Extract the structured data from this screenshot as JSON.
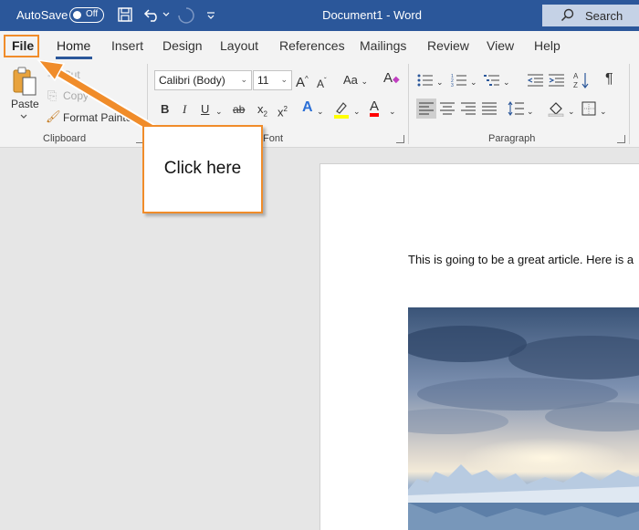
{
  "titlebar": {
    "autosave_label": "AutoSave",
    "autosave_state": "Off",
    "document_title": "Document1  -  Word",
    "search_placeholder": "Search",
    "icons": [
      "save-icon",
      "undo-icon",
      "redo-icon",
      "customize-quick-access-icon",
      "search-icon"
    ]
  },
  "tabs": [
    {
      "label": "File"
    },
    {
      "label": "Home"
    },
    {
      "label": "Insert"
    },
    {
      "label": "Design"
    },
    {
      "label": "Layout"
    },
    {
      "label": "References"
    },
    {
      "label": "Mailings"
    },
    {
      "label": "Review"
    },
    {
      "label": "View"
    },
    {
      "label": "Help"
    }
  ],
  "ribbon": {
    "clipboard": {
      "paste_label": "Paste",
      "cut_label": "Cut",
      "copy_label": "Copy",
      "format_painter_label": "Format Painter",
      "group_label": "Clipboard"
    },
    "font": {
      "font_name": "Calibri (Body)",
      "font_size": "11",
      "change_case_label": "Aa",
      "bold": "B",
      "italic": "I",
      "underline": "U",
      "strikethrough": "ab",
      "subscript": "x",
      "superscript": "x",
      "grow_font": "A",
      "shrink_font": "A",
      "text_effects": "A",
      "font_color": "A",
      "group_label": "Font"
    },
    "paragraph": {
      "group_label": "Paragraph",
      "show_marks": "¶"
    }
  },
  "callout": {
    "text": "Click here"
  },
  "document": {
    "body_text": "This is going to be a great article. Here is a"
  },
  "colors": {
    "title_bar": "#2b579a",
    "callout_border": "#f08c2a",
    "highlight_yellow": "#ffff00",
    "font_color_red": "#ff0000"
  }
}
